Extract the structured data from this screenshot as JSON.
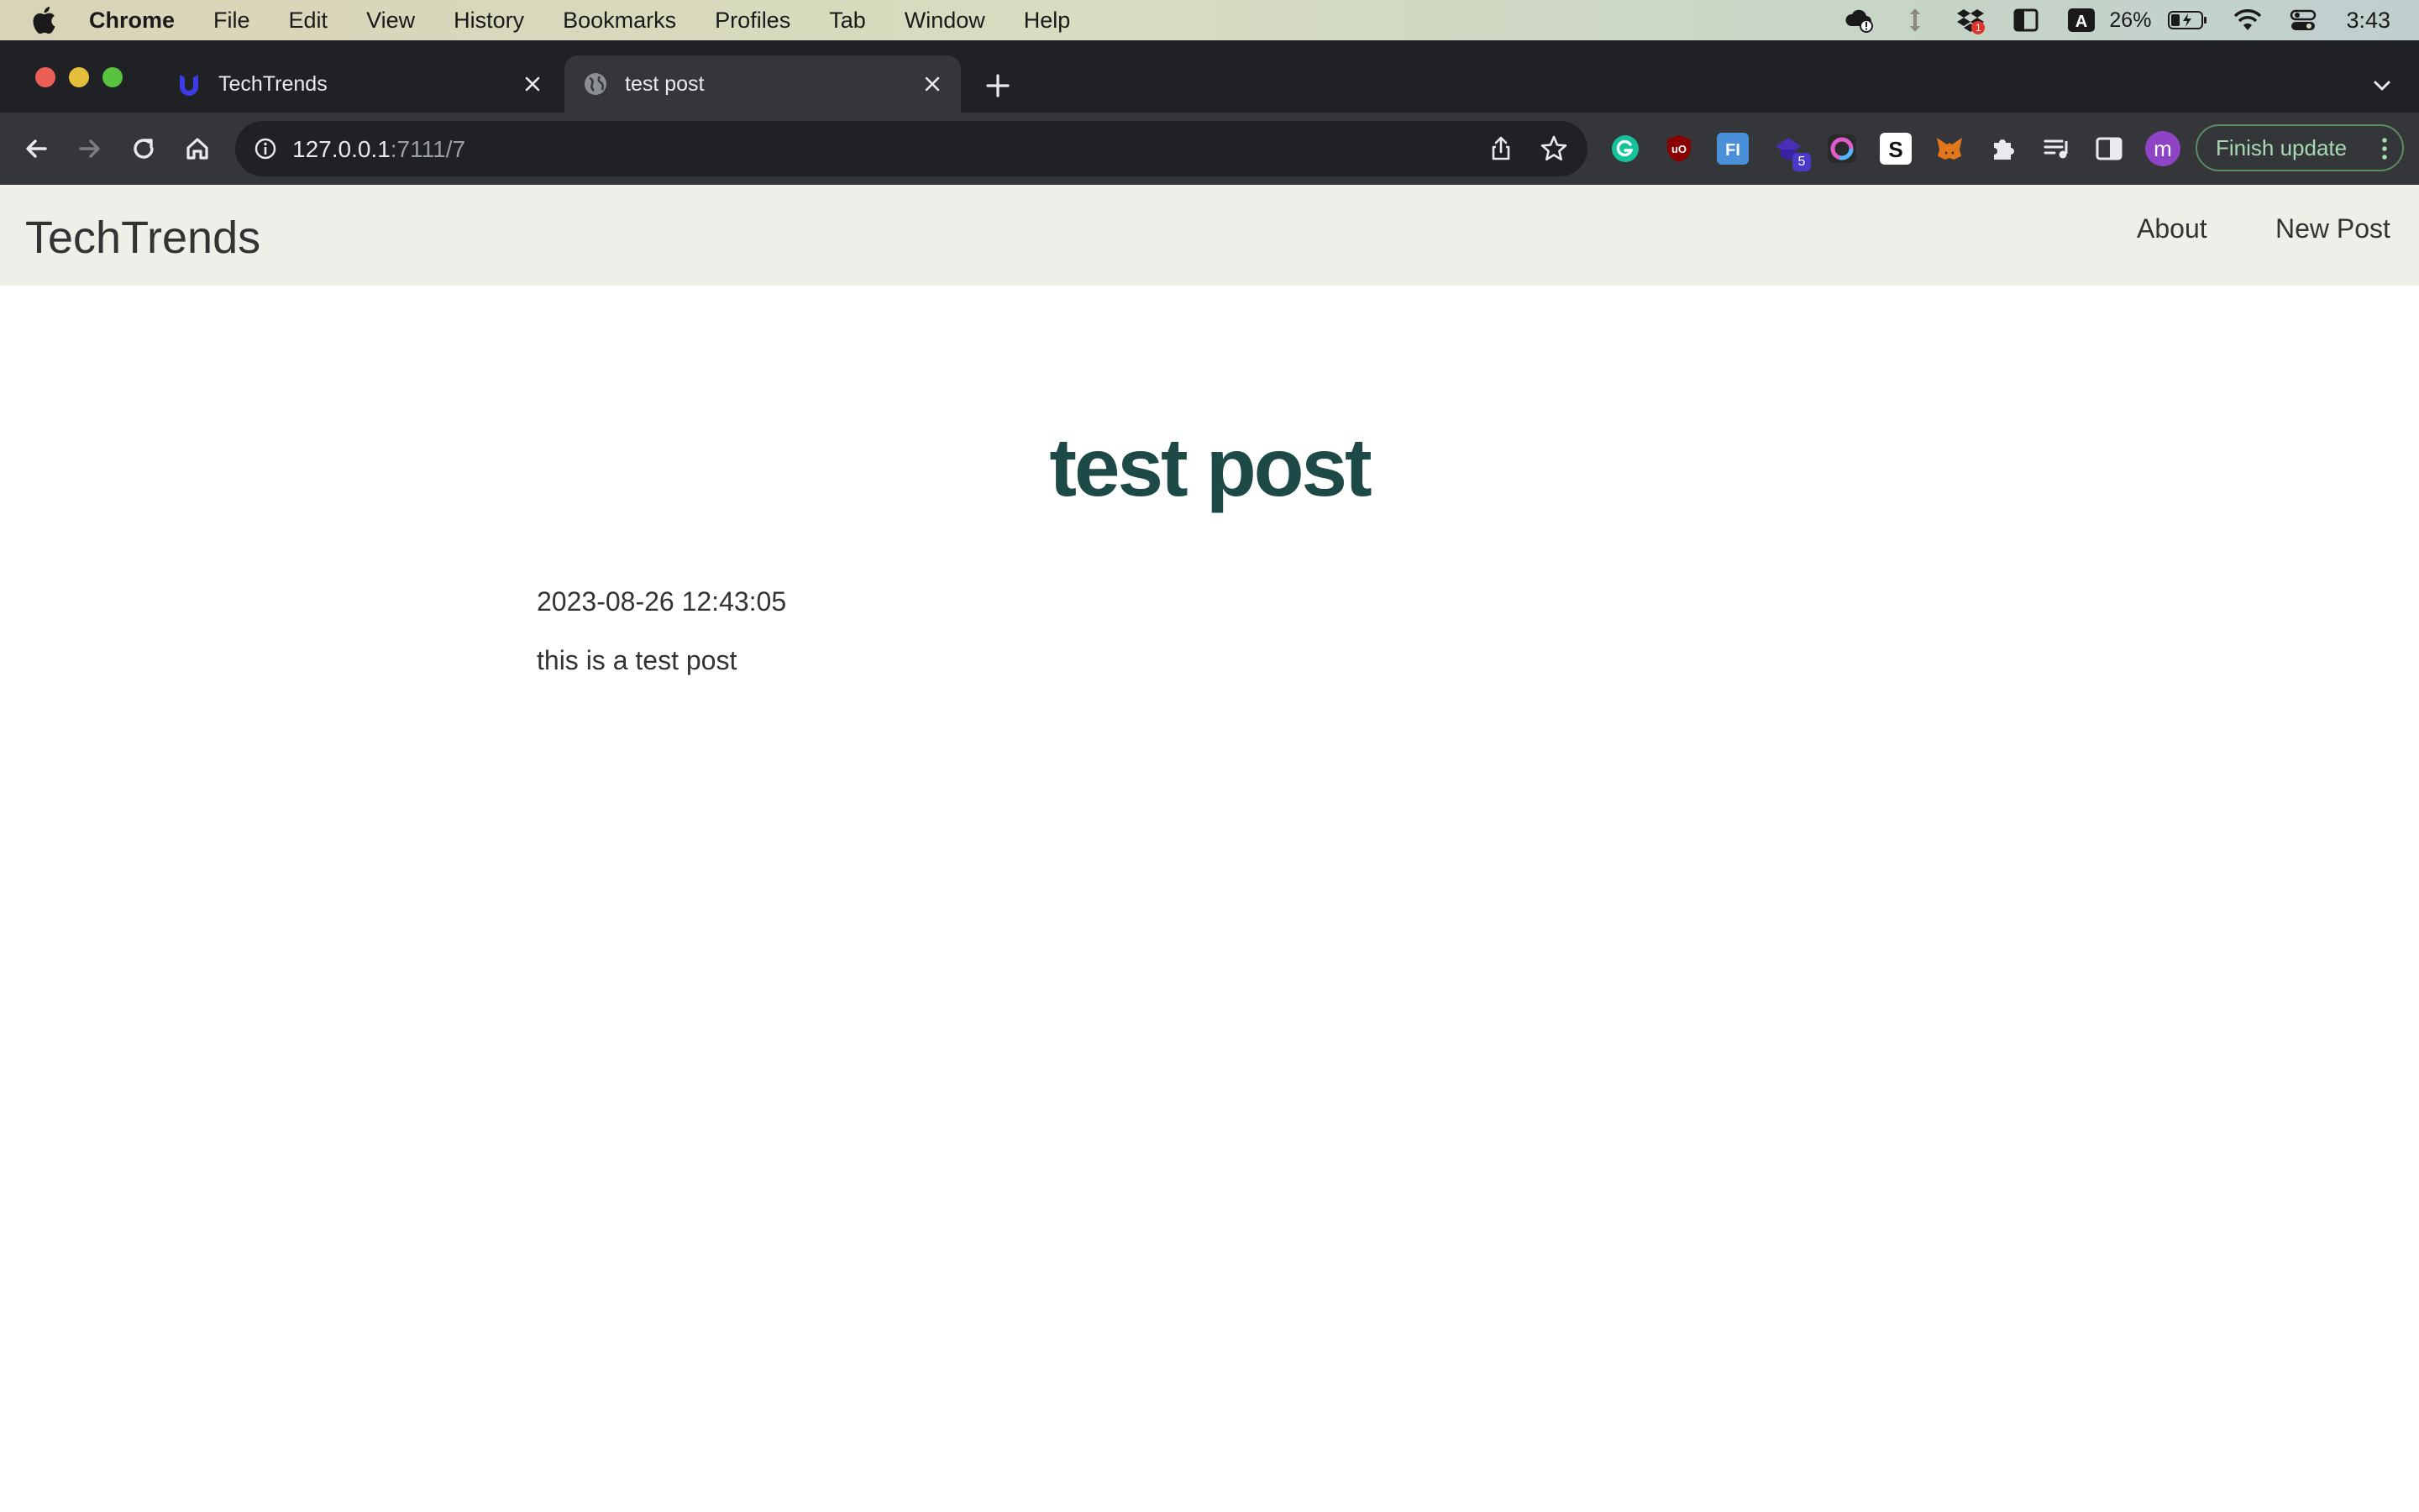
{
  "menubar": {
    "app_name": "Chrome",
    "items": [
      "File",
      "Edit",
      "View",
      "History",
      "Bookmarks",
      "Profiles",
      "Tab",
      "Window",
      "Help"
    ],
    "battery_percent": "26%",
    "clock": "3:43",
    "dropbox_badge": "1"
  },
  "browser": {
    "tabs": [
      {
        "title": "TechTrends",
        "icon": "udacity-icon",
        "active": false
      },
      {
        "title": "test post",
        "icon": "globe-icon",
        "active": true
      }
    ],
    "url_host": "127.0.0.1",
    "url_path": ":7111/7",
    "extension_badge": "5",
    "avatar_letter": "m",
    "finish_update_label": "Finish update"
  },
  "site": {
    "brand": "TechTrends",
    "nav": {
      "about": "About",
      "new_post": "New Post"
    }
  },
  "post": {
    "title": "test post",
    "date": "2023-08-26 12:43:05",
    "body": "this is a test post"
  },
  "colors": {
    "title": "#1d4a47",
    "nav_background": "#f0eee9",
    "tabstrip": "#202124",
    "toolbar": "#35363a"
  }
}
